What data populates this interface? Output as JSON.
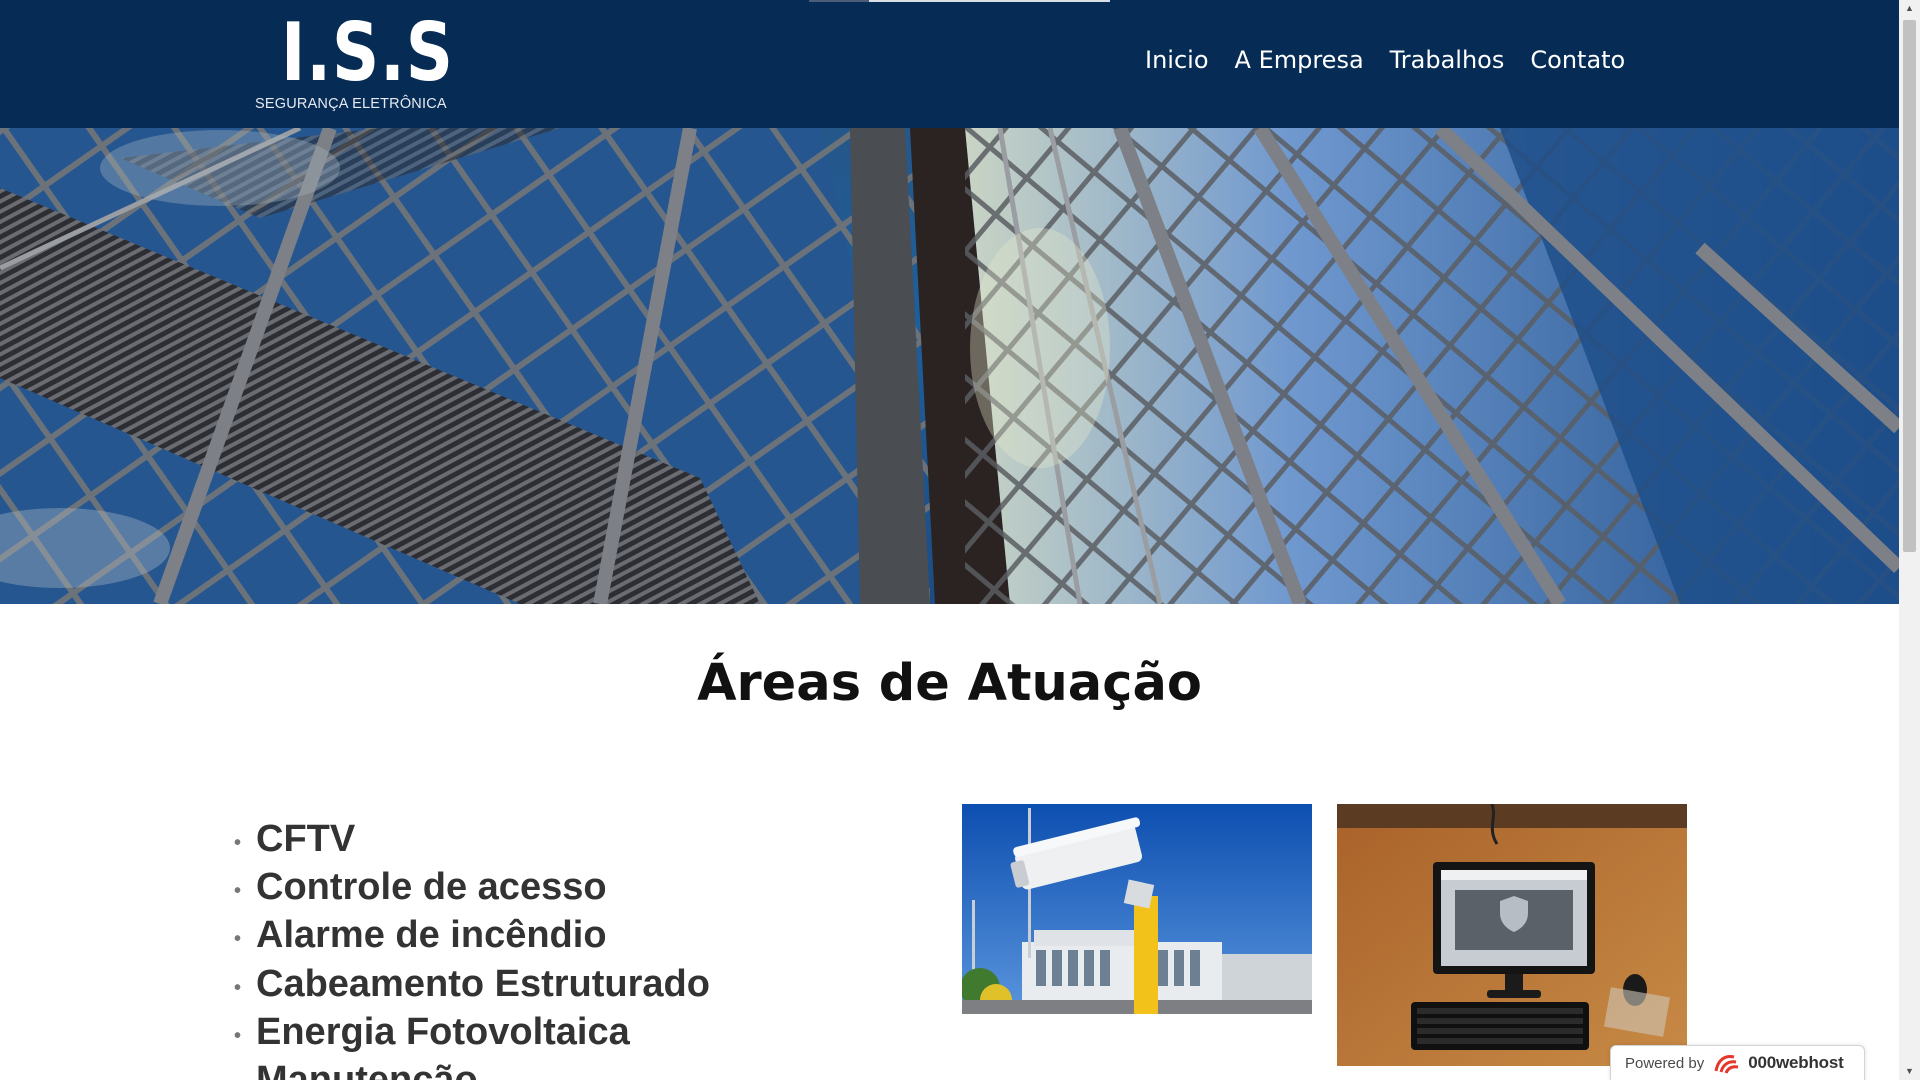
{
  "brand": {
    "logo_mark": "I.S.S",
    "logo_subtitle": "SEGURANÇA ELETRÔNICA"
  },
  "nav": {
    "items": [
      "Inicio",
      "A Empresa",
      "Trabalhos",
      "Contato"
    ]
  },
  "section": {
    "title": "Áreas de Atuação",
    "areas": [
      "CFTV",
      "Controle de acesso",
      "Alarme de incêndio",
      "Cabeamento Estruturado",
      "Energia Fotovoltaica",
      "Manutenção"
    ]
  },
  "footer_badge": {
    "powered_label": "Powered by",
    "brand": "000webhost"
  },
  "colors": {
    "header_bg": "#062b55",
    "text_dark": "#333333"
  }
}
